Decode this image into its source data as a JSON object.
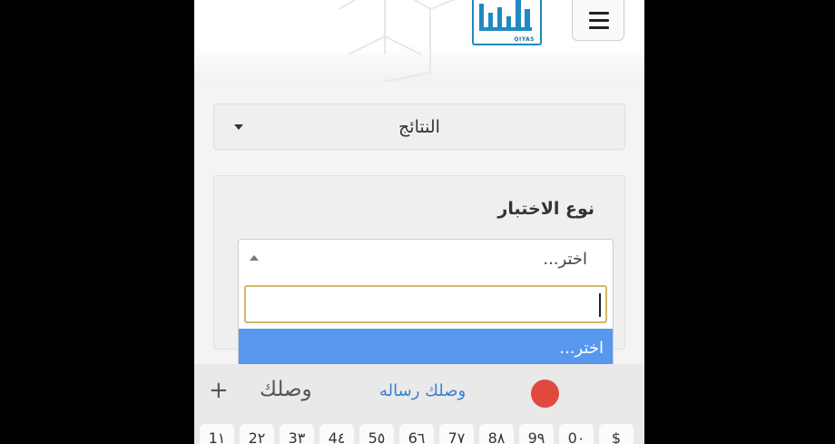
{
  "header": {
    "logo_text": "QIYAS",
    "menu_icon": "hamburger-icon"
  },
  "results_dropdown": {
    "label": "النتائج",
    "icon": "caret-down-icon"
  },
  "test_type": {
    "title": "نوع الاختبار",
    "select_value": "اختر...",
    "search_value": "",
    "options": [
      "اختر..."
    ]
  },
  "keyboard": {
    "plus": "+",
    "suggestions": [
      "وصلك",
      "وصلك رساله"
    ],
    "keys": [
      "1١",
      "2٢",
      "3٣",
      "4٤",
      "5٥",
      "6٦",
      "7٧",
      "8٨",
      "9٩",
      "0٠",
      "$"
    ]
  },
  "colors": {
    "highlight": "#5897ee",
    "search_border": "#d6b567",
    "logo": "#1f8ac0",
    "record": "#e2493e",
    "suggestion_link": "#3d7fcf"
  }
}
